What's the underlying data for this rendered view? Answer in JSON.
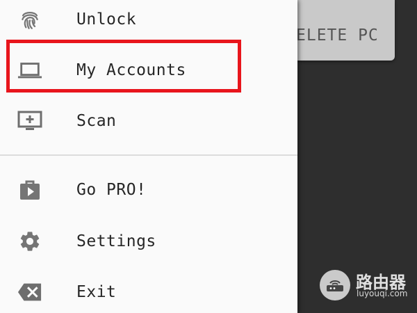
{
  "background_app": {
    "card_label": "ELETE PC"
  },
  "drawer": {
    "items": [
      {
        "label": "Unlock",
        "icon": "fingerprint-icon"
      },
      {
        "label": "My Accounts",
        "icon": "laptop-icon"
      },
      {
        "label": "Scan",
        "icon": "monitor-add-icon"
      },
      {
        "label": "Go PRO!",
        "icon": "play-store-icon"
      },
      {
        "label": "Settings",
        "icon": "gear-icon"
      },
      {
        "label": "Exit",
        "icon": "backspace-icon"
      }
    ],
    "highlighted_item": "My Accounts",
    "highlight_color": "#e8151c"
  },
  "watermark": {
    "title": "路由器",
    "url": "luyouqi.com"
  }
}
